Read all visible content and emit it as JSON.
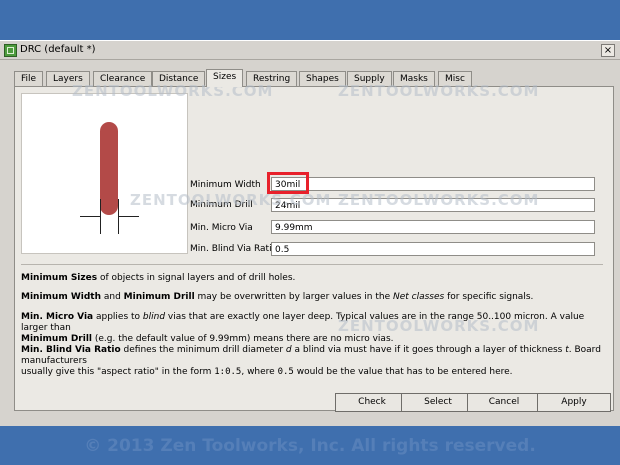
{
  "window": {
    "title": "DRC (default *)",
    "close_label": "×"
  },
  "tabs": [
    "File",
    "Layers",
    "Clearance",
    "Distance",
    "Sizes",
    "Restring",
    "Shapes",
    "Supply",
    "Masks",
    "Misc"
  ],
  "active_tab": "Sizes",
  "fields": [
    {
      "label": "Minimum Width",
      "value": "30mil"
    },
    {
      "label": "Minimum Drill",
      "value": "24mil"
    },
    {
      "label": "Min. Micro Via",
      "value": "9.99mm"
    },
    {
      "label": "Min. Blind Via Ratio",
      "value": "0.5"
    }
  ],
  "help": {
    "p1_bold": "Minimum Sizes",
    "p1_rest": " of objects in signal layers and of drill holes.",
    "p2_a": "Minimum Width",
    "p2_b": " and ",
    "p2_c": "Minimum Drill",
    "p2_d": " may be overwritten by larger values in the ",
    "p2_e": "Net classes",
    "p2_f": " for specific signals.",
    "p3_a": "Min. Micro Via",
    "p3_b": " applies to ",
    "p3_c": "blind",
    "p3_d": " vias that are exactly one layer deep. Typical values are in the range 50..100 micron. A value larger than",
    "p3_e": "Minimum Drill",
    "p3_f": " (e.g. the default value of 9.99mm) means there are no micro vias.",
    "p4_a": "Min. Blind Via Ratio",
    "p4_b": " defines the minimum drill diameter ",
    "p4_c": "d",
    "p4_d": " a blind via must have if it goes through a layer of thickness ",
    "p4_e": "t",
    "p4_f": ". Board manufacturers",
    "p4_g": "usually give this \"aspect ratio\" in the form ",
    "p4_h": "1:0.5",
    "p4_i": ", where ",
    "p4_j": "0.5",
    "p4_k": " would be the value that has to be entered here."
  },
  "buttons": {
    "check": "Check",
    "select": "Select",
    "cancel": "Cancel",
    "apply": "Apply"
  },
  "watermarks": [
    "ZENTOOLWORKS.COM",
    "ZENTOOLWORKS.COM",
    "ZENTOOLWORKS.COM",
    "ZENTOOLWORKS.COM",
    "ZENTOOLWORKS.COM"
  ],
  "copyright": "© 2013 Zen Toolworks, Inc. All rights reserved."
}
